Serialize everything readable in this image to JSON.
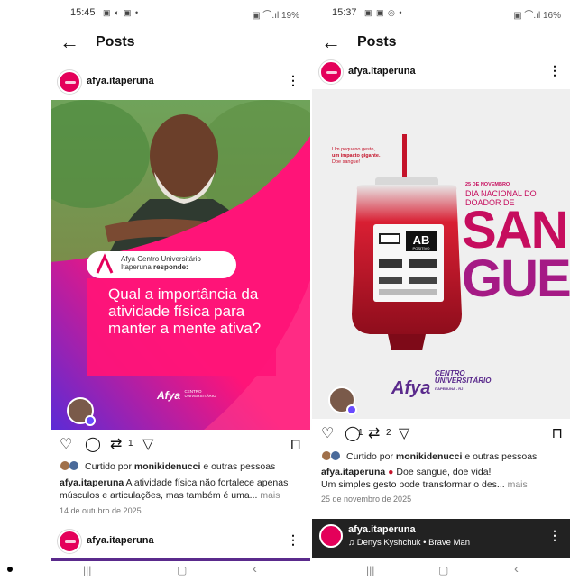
{
  "left": {
    "status": {
      "time": "15:45",
      "right": "19%"
    },
    "header": {
      "title": "Posts"
    },
    "post": {
      "username": "afya.itaperuna",
      "image": {
        "badge_line1": "Afya Centro Universitário",
        "badge_line2": "Itaperuna",
        "badge_responde": "responde:",
        "question": "Qual a importância da atividade física para manter a mente ativa?",
        "logo_afya": "Afya",
        "logo_sub1": "CENTRO",
        "logo_sub2": "UNIVERSITÁRIO"
      },
      "actions": {
        "comments": "1",
        "reposts": ""
      },
      "liked_prefix": "Curtido por",
      "liked_user": "monikidenucci",
      "liked_suffix": "e outras pessoas",
      "caption_user": "afya.itaperuna",
      "caption_text": "A atividade física não fortalece apenas músculos e articulações, mas também é uma...",
      "caption_more": "mais",
      "date": "14 de outubro de 2025"
    },
    "next_post": {
      "username": "afya.itaperuna"
    }
  },
  "right": {
    "status": {
      "time": "15:37",
      "right": "16%"
    },
    "header": {
      "title": "Posts"
    },
    "post": {
      "username": "afya.itaperuna",
      "image": {
        "small_l1": "Um pequeno gesto,",
        "small_l2": "um impacto gigante.",
        "small_l3": "Doe sangue!",
        "date_line": "25 DE NOVEMBRO",
        "day_l1": "DIA NACIONAL DO",
        "day_l2": "DOADOR DE",
        "big1": "SAN",
        "big2": "GUE",
        "blood_type": "AB",
        "blood_sub": "POSITIVO",
        "logo_afya": "Afya",
        "logo_sub1": "CENTRO",
        "logo_sub2": "UNIVERSITÁRIO",
        "logo_sub3": "ITAPERUNA - RJ"
      },
      "actions": {
        "comments": "1",
        "reposts": "2"
      },
      "liked_prefix": "Curtido por",
      "liked_user": "monikidenucci",
      "liked_suffix": "e outras pessoas",
      "caption_user": "afya.itaperuna",
      "caption_line1": "Doe sangue, doe vida!",
      "caption_line2": "Um simples gesto pode transformar o des...",
      "caption_more": "mais",
      "date": "25 de novembro de 2025"
    },
    "next_post": {
      "username": "afya.itaperuna",
      "music": "Denys Kyshchuk • Brave Man"
    }
  },
  "icons": {
    "back": "←",
    "kebab": "⋮",
    "heart": "♡",
    "comment": "◯",
    "repost": "⇄",
    "share": "▽",
    "save": "⊓",
    "nav_recent": "|||",
    "nav_home": "▢",
    "nav_back": "‹",
    "music": "♫",
    "blood_drop": "💧"
  },
  "colors": {
    "brand_pink": "#e4005a",
    "brand_magenta": "#ff1478",
    "afya_purple": "#5a2a8c",
    "blood": "#c4132a"
  }
}
